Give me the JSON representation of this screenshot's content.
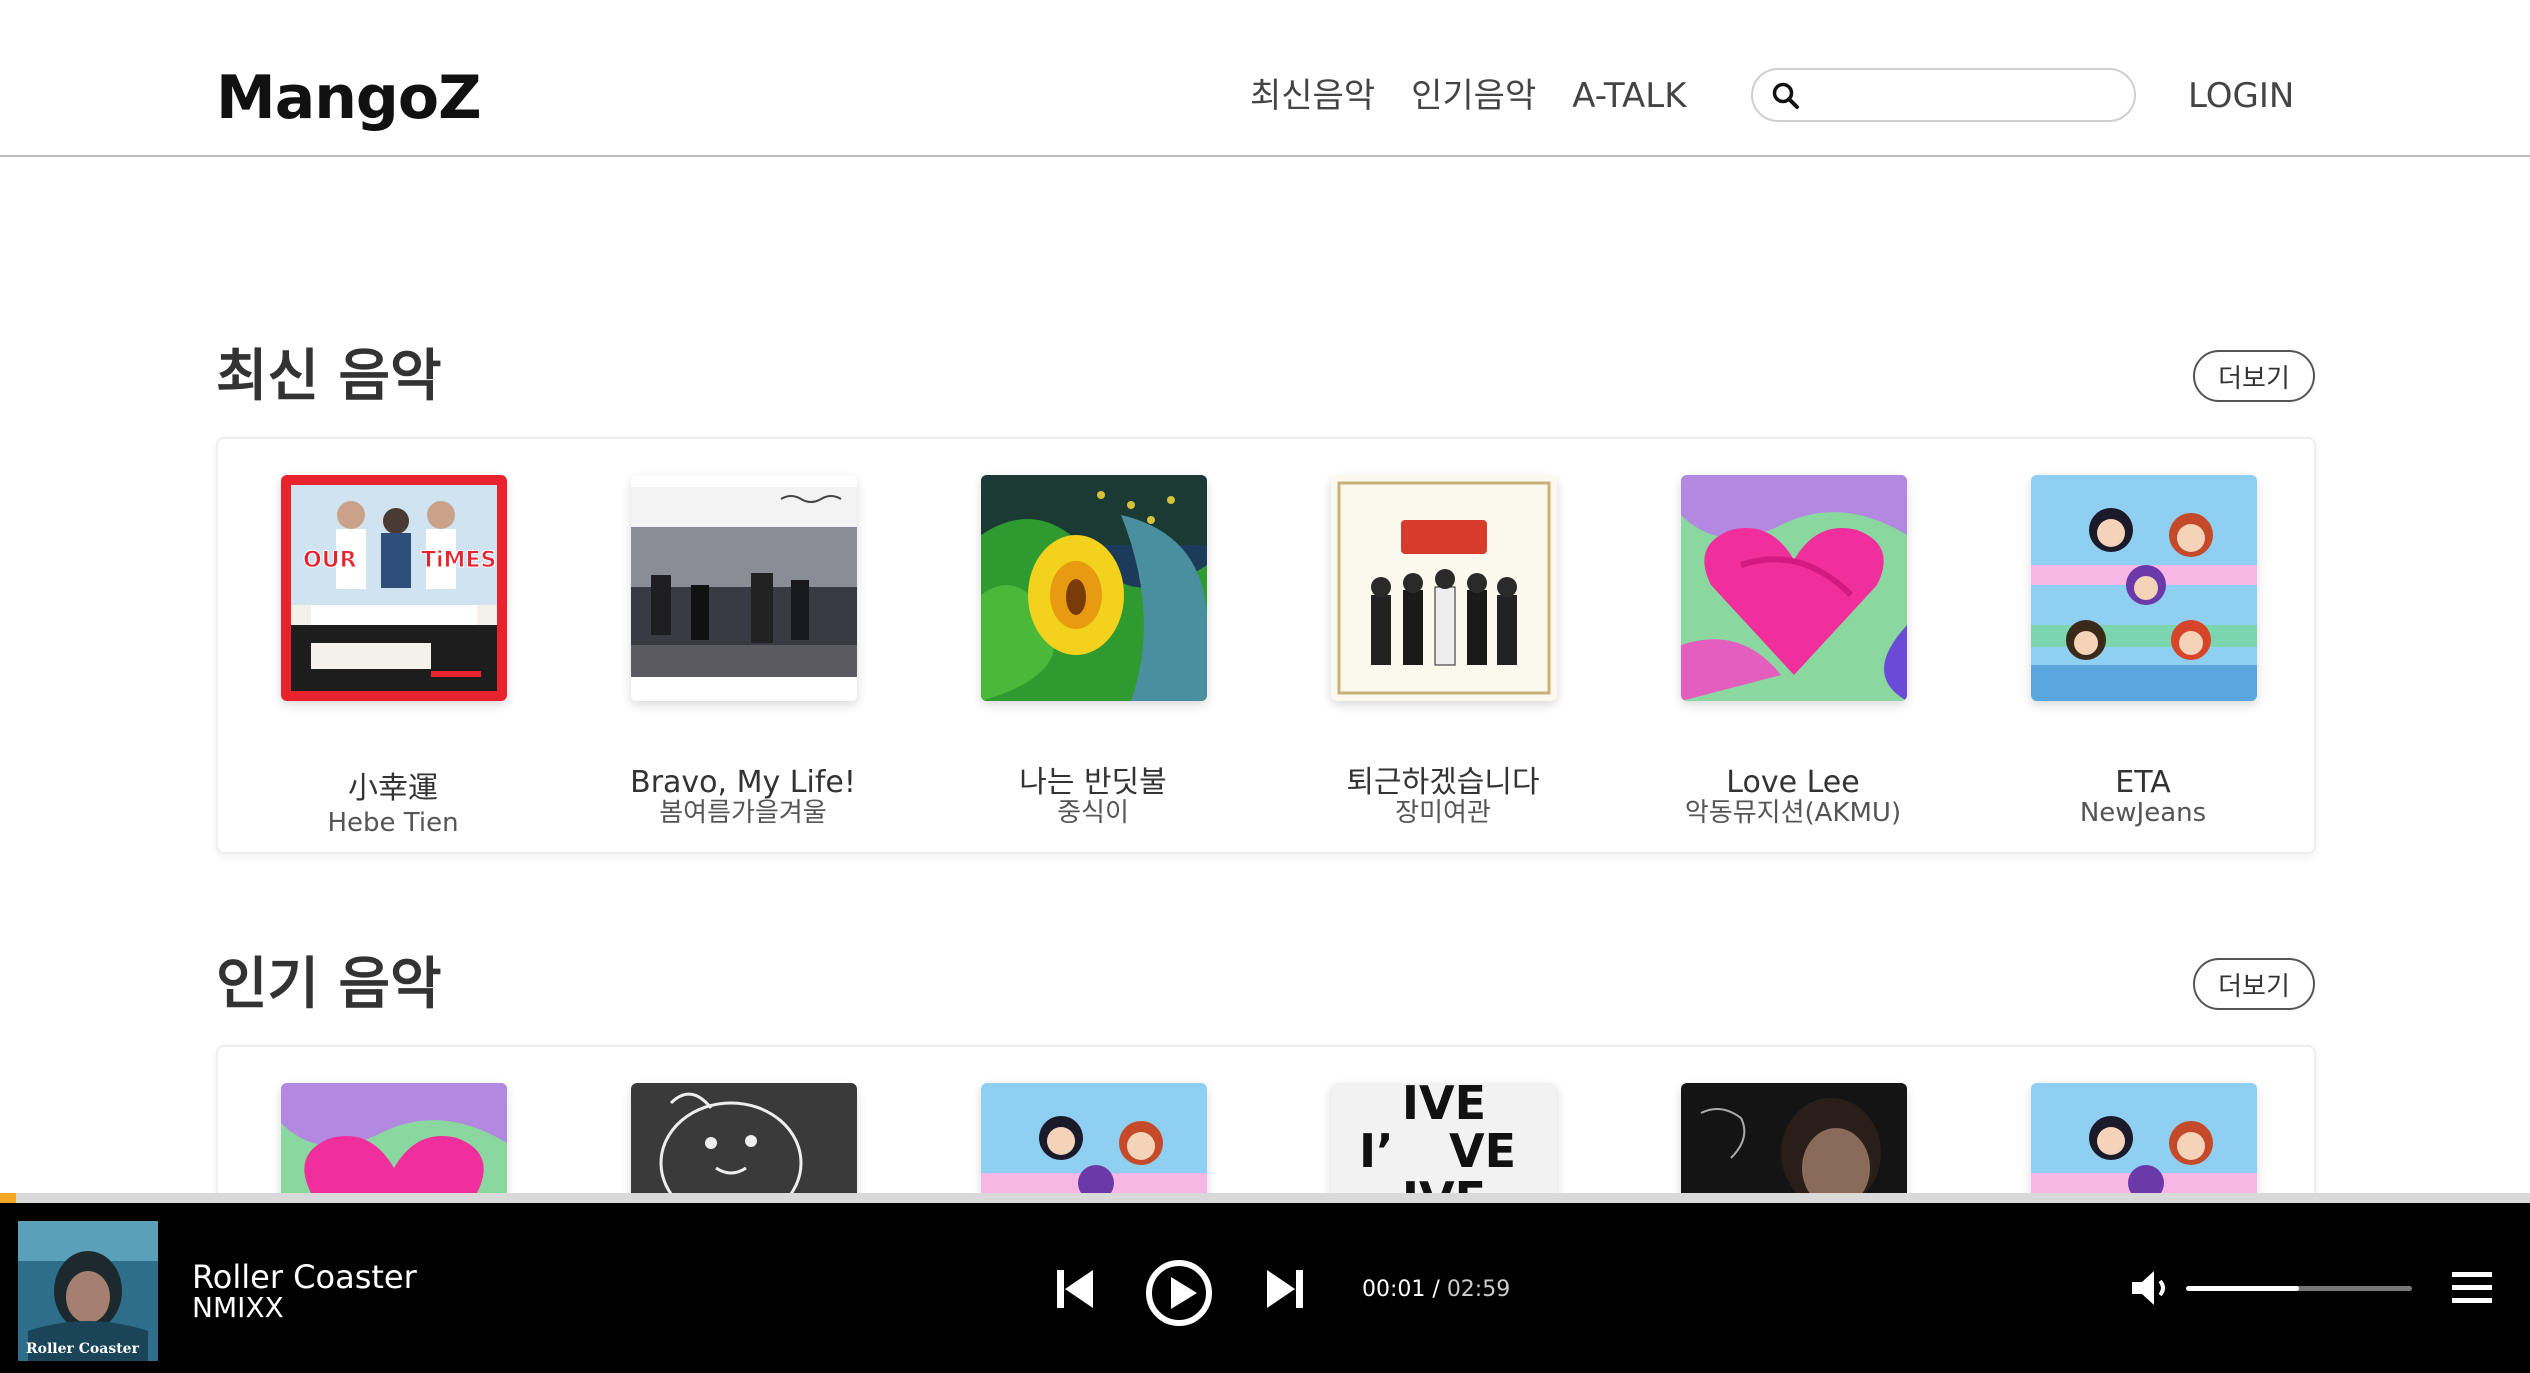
{
  "header": {
    "logo": "MangoZ",
    "nav": [
      "최신음악",
      "인기음악",
      "A-TALK"
    ],
    "search_placeholder": "",
    "login_label": "LOGIN"
  },
  "latest": {
    "title": "최신 음악",
    "more_label": "더보기",
    "items": [
      {
        "title": "小幸運",
        "artist": "Hebe Tien",
        "icon": "our-times-cover"
      },
      {
        "title": "Bravo, My Life!",
        "artist": "봄여름가을겨울",
        "icon": "bravo-my-life-cover"
      },
      {
        "title": "나는 반딧불",
        "artist": "중식이",
        "icon": "firefly-cover"
      },
      {
        "title": "퇴근하겠습니다",
        "artist": "장미여관",
        "icon": "jangmi-cover"
      },
      {
        "title": "Love Lee",
        "artist": "악동뮤지션(AKMU)",
        "icon": "heart-cover"
      },
      {
        "title": "ETA",
        "artist": "NewJeans",
        "icon": "newjeans-cover"
      }
    ]
  },
  "popular": {
    "title": "인기 음악",
    "more_label": "더보기",
    "items": [
      {
        "icon": "heart-cover"
      },
      {
        "icon": "sketch-cover"
      },
      {
        "icon": "newjeans-cover"
      },
      {
        "icon": "ive-cover",
        "cover_text_1": "IVE",
        "cover_text_2": "I’",
        "cover_text_3": "VE",
        "cover_text_4": "IVE"
      },
      {
        "icon": "dark-portrait-cover"
      },
      {
        "icon": "newjeans-cover"
      }
    ]
  },
  "player": {
    "title": "Roller Coaster",
    "artist": "NMIXX",
    "cover_text": "Roller Coaster",
    "current_time": "00:01",
    "separator": " / ",
    "total_time": "02:59",
    "progress_fraction": 0.006,
    "volume_fraction": 0.5,
    "accent_color": "#f5a623"
  }
}
